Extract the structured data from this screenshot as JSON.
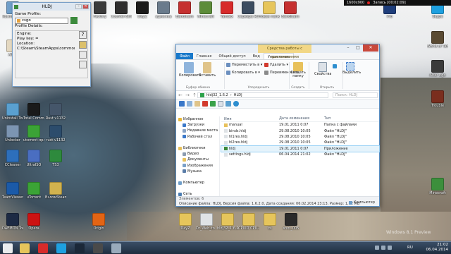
{
  "desktop_icons": [
    {
      "id": "computer",
      "label": "Компьютер",
      "color": "#6f9ec9"
    },
    {
      "id": "aimp",
      "label": "AIMP",
      "color": "#e4d8c0"
    },
    {
      "id": "uninstall",
      "label": "Uninstall Tool",
      "color": "#5aa0d0"
    },
    {
      "id": "unlocker",
      "label": "Unlocker",
      "color": "#7c95b2"
    },
    {
      "id": "ccleaner",
      "label": "CCleaner",
      "color": "#2d6fbb"
    },
    {
      "id": "teamviewer",
      "label": "TeamViewer",
      "color": "#1b5aa8"
    },
    {
      "id": "daemon",
      "label": "DAEMON Tools Lite",
      "color": "#1d2a44"
    },
    {
      "id": "total-commander",
      "label": "Total Commander",
      "color": "#1a1a1a"
    },
    {
      "id": "utorrent-shortcut",
      "label": "utorrent-ярлык",
      "color": "#3ba336"
    },
    {
      "id": "ultraiso",
      "label": "UltraISO",
      "color": "#4a6ec1"
    },
    {
      "id": "utorrent",
      "label": "uTorrent",
      "color": "#3ba336"
    },
    {
      "id": "opera",
      "label": "Opera",
      "color": "#cc1212"
    },
    {
      "id": "rust",
      "label": "Rust v1132",
      "color": "#45566a"
    },
    {
      "id": "rust2",
      "label": "rust-v1132",
      "color": "#2c4c6c"
    },
    {
      "id": "ts3",
      "label": "TS3",
      "color": "#2e8a3d"
    },
    {
      "id": "vzlomsteam",
      "label": "ВзломSteam",
      "color": "#d1b24e"
    },
    {
      "id": "origin",
      "label": "Origin",
      "color": "#e36414"
    },
    {
      "id": "factory",
      "label": "Factory",
      "color": "#3a3a3a"
    },
    {
      "id": "go",
      "label": "Counter-Strike Global Offe...",
      "color": "#2e2e2e"
    },
    {
      "id": "dayz",
      "label": "DayZ",
      "color": "#1b1b1b"
    },
    {
      "id": "admin",
      "label": "админка",
      "color": "#6a7b8c"
    },
    {
      "id": "bandicam",
      "label": "Bandicam",
      "color": "#c53030"
    },
    {
      "id": "minecraft",
      "label": "Minecraft",
      "color": "#5d8c3a"
    },
    {
      "id": "yandex",
      "label": "Yandex",
      "color": "#d72b2b"
    },
    {
      "id": "servers",
      "label": "Сервера RUST v1132",
      "color": "#3b4c60"
    },
    {
      "id": "newfolder",
      "label": "Новая папка (3)",
      "color": "#e6c55b"
    },
    {
      "id": "bandicam2",
      "label": "Bandicam",
      "color": "#c53030"
    },
    {
      "id": "pro",
      "label": "Pro",
      "color": "#1e3d7a"
    },
    {
      "id": "skype",
      "label": "Skype",
      "color": "#1ea0e0"
    },
    {
      "id": "warofwar",
      "label": "World of Tanks",
      "color": "#5a4a32"
    },
    {
      "id": "alter",
      "label": "Alter Ego",
      "color": "#3a3a3a"
    },
    {
      "id": "trouble",
      "label": "Trouble",
      "color": "#7a2e1e"
    },
    {
      "id": "mc",
      "label": "Minecraft",
      "color": "#3c8f3c"
    },
    {
      "id": "dayz-file",
      "label": "DayZ",
      "color": "#e6c55b"
    },
    {
      "id": "drweb",
      "label": "Dr_Web_to...",
      "color": "#dfe3e6"
    },
    {
      "id": "hldj-zip",
      "label": "hldj32_1.6.2",
      "color": "#e6c55b"
    },
    {
      "id": "cpuid",
      "label": "CPUID CPU-Z",
      "color": "#e6c55b"
    },
    {
      "id": "cs",
      "label": "cs",
      "color": "#e6c55b"
    },
    {
      "id": "shot",
      "label": "shot_005",
      "color": "#2a2a2a"
    }
  ],
  "hldj": {
    "title": "HLDJ",
    "game_profile_label": "Game Profile:",
    "game_profile_value": "csgo",
    "profile_details_label": "Profile Details:",
    "engine": "Engine:",
    "play_key": "Play key: =",
    "location": "Location:",
    "location_path": "C:\\Steam\\SteamApps\\common\\C"
  },
  "explorer": {
    "title": "HLDJ",
    "app_tools": "Средства работы с приложениями",
    "tabs": [
      "Файл",
      "Главная",
      "Общий доступ",
      "Вид",
      "Управление"
    ],
    "ribbon": {
      "copy": "Копировать",
      "paste": "Вставить",
      "move_to": "Переместить в ▾",
      "copy_to": "Копировать в ▾",
      "delete": "Удалить ▾",
      "rename": "Переименовать",
      "new_folder": "Создать папку",
      "properties": "Свойства",
      "select": "Выделить",
      "group_clipboard": "Буфер обмена",
      "group_organize": "Упорядочить",
      "group_create": "Создать",
      "group_open": "Открыть"
    },
    "address_parts": [
      "hldj32_1.6.2",
      "HLDJ"
    ],
    "search_placeholder": "Поиск: HLDJ",
    "nav_items": [
      {
        "label": "Избранное",
        "color": "#e8b83a"
      },
      {
        "label": "Загрузки",
        "color": "#3a78c9"
      },
      {
        "label": "Недавние места",
        "color": "#8aa4c6"
      },
      {
        "label": "Рабочий стол",
        "color": "#3a78c9"
      },
      {
        "label": "",
        "color": "transparent"
      },
      {
        "label": "Библиотеки",
        "color": "#e8c15b"
      },
      {
        "label": "Видео",
        "color": "#8a9bb0"
      },
      {
        "label": "Документы",
        "color": "#e8c15b"
      },
      {
        "label": "Изображения",
        "color": "#7aa0c8"
      },
      {
        "label": "Музыка",
        "color": "#5a7da8"
      },
      {
        "label": "",
        "color": "transparent"
      },
      {
        "label": "Компьютер",
        "color": "#6f9ec9"
      },
      {
        "label": "",
        "color": "transparent"
      },
      {
        "label": "Сеть",
        "color": "#4c7db1"
      }
    ],
    "columns": [
      "Имя",
      "Дата изменения",
      "Тип"
    ],
    "files": [
      {
        "name": "manual",
        "date": "19.01.2011 0:07",
        "type": "Папка с файлами",
        "color": "#e8c15b"
      },
      {
        "name": "binds.hldj",
        "date": "29.08.2010 10:05",
        "type": "Файл \"HLDJ\"",
        "color": "#dfe3e6"
      },
      {
        "name": "hl1res.hldj",
        "date": "29.08.2010 10:05",
        "type": "Файл \"HLDJ\"",
        "color": "#dfe3e6"
      },
      {
        "name": "hl2res.hldj",
        "date": "29.08.2010 10:05",
        "type": "Файл \"HLDJ\"",
        "color": "#dfe3e6"
      },
      {
        "name": "hldj",
        "date": "19.01.2011 0:07",
        "type": "Приложение",
        "color": "#3c8a3c"
      },
      {
        "name": "settings.hldj",
        "date": "06.04.2014 21:02",
        "type": "Файл \"HLDJ\"",
        "color": "#dfe3e6"
      }
    ],
    "item_count": "Элементов: 6",
    "status_line": "Описание файла: HLDJ, Версия файла: 1.6.2.0, Дата создания: 06.02.2014 23:13, Размер: 1,82 МБ",
    "selected": "1 элемент",
    "computer": "Компьютер"
  },
  "recorder": {
    "resolution": "1600x900",
    "rec_text": "Запись [00:02:09]"
  },
  "taskbar": {
    "lang": "RU",
    "time": "21:02",
    "date": "06.04.2014"
  },
  "watermark": "Windows 8.1 Preview"
}
